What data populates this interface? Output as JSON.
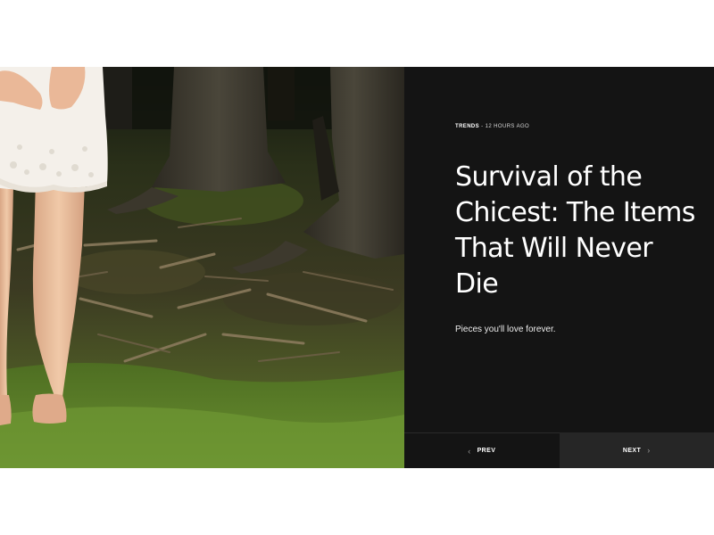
{
  "article": {
    "category": "TRENDS",
    "separator": " - ",
    "time_ago": "12 HOURS AGO",
    "title": "Survival of the Chicest: The Items That Will Never Die",
    "subtitle": "Pieces you'll love forever."
  },
  "pager": {
    "prev_label": "PREV",
    "next_label": "NEXT",
    "prev_icon": "chevron-left-icon",
    "next_icon": "chevron-right-icon"
  },
  "hero_image": {
    "subject": "woman-in-white-lace-dress-standing-in-forest"
  },
  "colors": {
    "panel_background": "#141414",
    "next_button_background": "#262626",
    "text": "#ffffff"
  }
}
